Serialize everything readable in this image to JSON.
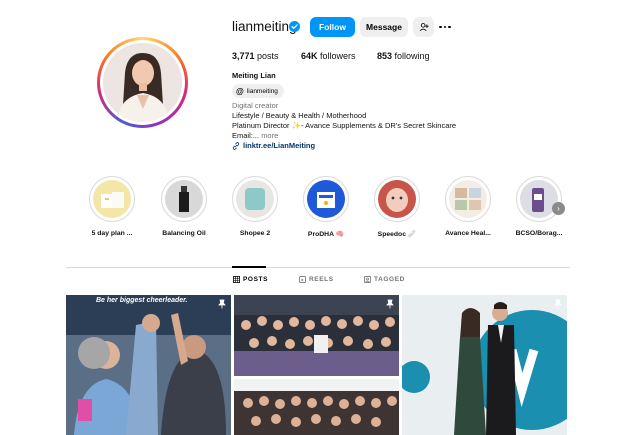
{
  "profile": {
    "username": "lianmeiting",
    "full_name": "Meiting Lian",
    "threads_handle": "lianmeiting",
    "category": "Digital creator",
    "bio_lines": [
      "Lifestyle / Beauty & Health / Motherhood",
      "Platinum Director ✨- Avance Supplements & DR's Secret Skincare"
    ],
    "bio_truncated": "Email:...",
    "more_label": "more",
    "link": "linktr.ee/LianMeiting"
  },
  "actions": {
    "follow_label": "Follow",
    "message_label": "Message"
  },
  "stats": {
    "posts_count": "3,771",
    "posts_label": "posts",
    "followers_count": "64K",
    "followers_label": "followers",
    "following_count": "853",
    "following_label": "following"
  },
  "highlights": [
    {
      "label": "5 day plan ..."
    },
    {
      "label": "Balancing Oil"
    },
    {
      "label": "Shopee 2"
    },
    {
      "label": "ProDHA 🧠"
    },
    {
      "label": "Speedoc 🩹"
    },
    {
      "label": "Avance Heal..."
    },
    {
      "label": "BCSO/Borag..."
    }
  ],
  "tabs": [
    {
      "label": "POSTS",
      "active": true
    },
    {
      "label": "REELS",
      "active": false
    },
    {
      "label": "TAGGED",
      "active": false
    }
  ],
  "posts": [
    {
      "caption": "Be her biggest cheerleader."
    }
  ],
  "colors": {
    "accent": "#0095f6",
    "link": "#00376b",
    "verified": "#0095f6",
    "muted": "#737373"
  },
  "icons": [
    "verified-badge-icon",
    "add-person-icon",
    "more-options-icon",
    "threads-icon",
    "link-icon",
    "grid-icon",
    "reels-icon",
    "tagged-icon",
    "pinned-icon",
    "chevron-right-icon"
  ]
}
